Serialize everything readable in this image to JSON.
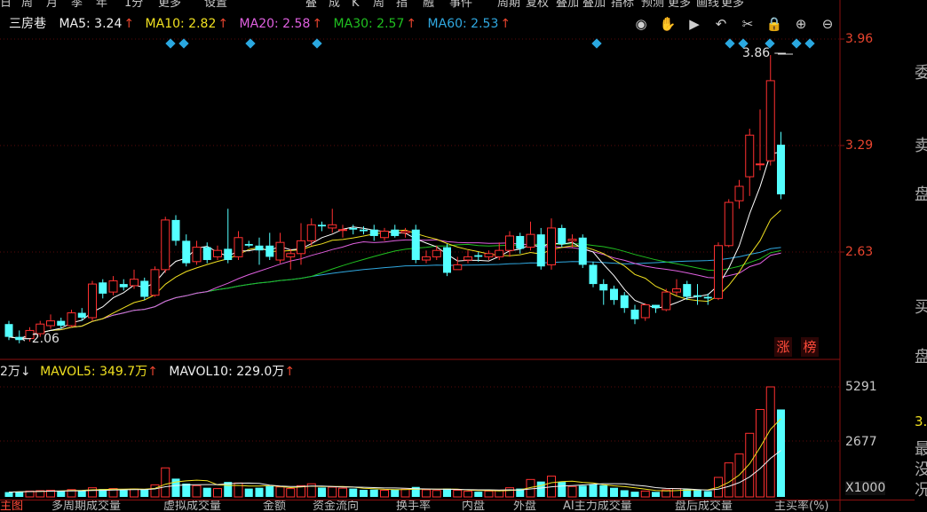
{
  "toolbar": {
    "items": [
      "日",
      "周",
      "月",
      "季",
      "年",
      "1分",
      "更多",
      "设置",
      "叠",
      "成",
      "K",
      "周",
      "指",
      "融",
      "事件",
      "周期",
      "复权",
      "叠加",
      "叠加",
      "指标",
      "预测",
      "更多",
      "画线",
      "更多"
    ]
  },
  "ma": {
    "stock_name": "三房巷",
    "ma5": "MA5: 3.24",
    "ma10": "MA10: 2.82",
    "ma20": "MA20: 2.58",
    "ma30": "MA30: 2.57",
    "ma60": "MA60: 2.53",
    "arrow": "↑",
    "colors": {
      "ma5": "#ffffff",
      "ma10": "#f0e020",
      "ma20": "#e060e0",
      "ma30": "#20c020",
      "ma60": "#30a8e0"
    }
  },
  "icons": [
    "eye-icon",
    "hand-icon",
    "play-icon",
    "undo-icon",
    "scissors-icon",
    "lock-icon",
    "zoom-in-icon",
    "zoom-out-icon"
  ],
  "price_axis": {
    "labels": [
      "3.96",
      "3.29",
      "2.63"
    ]
  },
  "annotations": {
    "high": "3.86",
    "low": "2.06"
  },
  "badges": [
    "涨",
    "榜"
  ],
  "volume": {
    "vol_prefix": "2万↓",
    "mavol5": "MAVOL5: 349.7万",
    "mavol10": "MAVOL10: 229.0万",
    "arrow": "↑",
    "axis": [
      "5291",
      "2677"
    ],
    "unit": "X1000"
  },
  "side_panel": [
    "委",
    "卖",
    "盘",
    "买",
    "盘",
    "3.",
    "最",
    "没",
    "况"
  ],
  "bottom_tabs": [
    "主图",
    "多周期成交量",
    "虚拟成交量",
    "金额",
    "资金流向",
    "换手率",
    "内盘",
    "外盘",
    "AI主力成交量",
    "盘后成交量",
    "主买率(%)"
  ],
  "chart_data": {
    "type": "candlestick",
    "price_axis_ticks": [
      3.96,
      3.29,
      2.63
    ],
    "volume_axis_ticks": [
      5291,
      2677
    ],
    "candles": [
      [
        2.18,
        2.1,
        2.2,
        2.08,
        210
      ],
      [
        2.1,
        2.08,
        2.14,
        2.06,
        230
      ],
      [
        2.09,
        2.14,
        2.16,
        2.07,
        260
      ],
      [
        2.12,
        2.18,
        2.2,
        2.1,
        280
      ],
      [
        2.17,
        2.2,
        2.24,
        2.15,
        300
      ],
      [
        2.2,
        2.17,
        2.22,
        2.15,
        270
      ],
      [
        2.17,
        2.25,
        2.27,
        2.16,
        330
      ],
      [
        2.25,
        2.22,
        2.28,
        2.2,
        290
      ],
      [
        2.22,
        2.43,
        2.45,
        2.2,
        420
      ],
      [
        2.44,
        2.37,
        2.46,
        2.34,
        360
      ],
      [
        2.38,
        2.45,
        2.48,
        2.36,
        380
      ],
      [
        2.43,
        2.41,
        2.46,
        2.39,
        300
      ],
      [
        2.42,
        2.46,
        2.52,
        2.4,
        360
      ],
      [
        2.45,
        2.35,
        2.47,
        2.33,
        340
      ],
      [
        2.36,
        2.52,
        2.54,
        2.35,
        560
      ],
      [
        2.52,
        2.83,
        2.85,
        2.5,
        1380
      ],
      [
        2.83,
        2.7,
        2.86,
        2.67,
        860
      ],
      [
        2.7,
        2.56,
        2.74,
        2.54,
        620
      ],
      [
        2.57,
        2.66,
        2.7,
        2.55,
        520
      ],
      [
        2.66,
        2.58,
        2.69,
        2.56,
        420
      ],
      [
        2.6,
        2.64,
        2.67,
        2.58,
        380
      ],
      [
        2.65,
        2.58,
        2.9,
        2.56,
        700
      ],
      [
        2.6,
        2.72,
        2.76,
        2.58,
        650
      ],
      [
        2.68,
        2.67,
        2.7,
        2.66,
        380
      ],
      [
        2.67,
        2.64,
        2.72,
        2.55,
        420
      ],
      [
        2.67,
        2.6,
        2.75,
        2.58,
        500
      ],
      [
        2.58,
        2.69,
        2.75,
        2.56,
        460
      ],
      [
        2.6,
        2.62,
        2.65,
        2.52,
        380
      ],
      [
        2.62,
        2.7,
        2.81,
        2.55,
        520
      ],
      [
        2.7,
        2.8,
        2.84,
        2.67,
        610
      ],
      [
        2.8,
        2.79,
        2.82,
        2.76,
        430
      ],
      [
        2.78,
        2.8,
        2.9,
        2.75,
        450
      ],
      [
        2.77,
        2.77,
        2.8,
        2.72,
        400
      ],
      [
        2.78,
        2.77,
        2.8,
        2.74,
        380
      ],
      [
        2.77,
        2.76,
        2.79,
        2.74,
        320
      ],
      [
        2.77,
        2.73,
        2.8,
        2.7,
        330
      ],
      [
        2.72,
        2.76,
        2.78,
        2.7,
        300
      ],
      [
        2.77,
        2.73,
        2.8,
        2.72,
        340
      ],
      [
        2.75,
        2.76,
        2.78,
        2.72,
        350
      ],
      [
        2.77,
        2.58,
        2.8,
        2.56,
        460
      ],
      [
        2.58,
        2.6,
        2.64,
        2.56,
        320
      ],
      [
        2.6,
        2.64,
        2.67,
        2.58,
        290
      ],
      [
        2.66,
        2.5,
        2.68,
        2.48,
        380
      ],
      [
        2.52,
        2.55,
        2.6,
        2.52,
        300
      ],
      [
        2.58,
        2.6,
        2.64,
        2.56,
        250
      ],
      [
        2.61,
        2.6,
        2.63,
        2.57,
        230
      ],
      [
        2.6,
        2.62,
        2.64,
        2.58,
        260
      ],
      [
        2.6,
        2.64,
        2.69,
        2.58,
        280
      ],
      [
        2.64,
        2.73,
        2.76,
        2.6,
        420
      ],
      [
        2.73,
        2.65,
        2.75,
        2.62,
        380
      ],
      [
        2.66,
        2.74,
        2.82,
        2.64,
        820
      ],
      [
        2.74,
        2.54,
        2.78,
        2.52,
        720
      ],
      [
        2.55,
        2.78,
        2.84,
        2.52,
        980
      ],
      [
        2.78,
        2.68,
        2.8,
        2.66,
        700
      ],
      [
        2.7,
        2.71,
        2.74,
        2.66,
        480
      ],
      [
        2.72,
        2.55,
        2.74,
        2.53,
        520
      ],
      [
        2.55,
        2.43,
        2.57,
        2.41,
        600
      ],
      [
        2.43,
        2.39,
        2.46,
        2.3,
        540
      ],
      [
        2.4,
        2.33,
        2.42,
        2.3,
        420
      ],
      [
        2.36,
        2.28,
        2.38,
        2.25,
        300
      ],
      [
        2.27,
        2.21,
        2.3,
        2.18,
        230
      ],
      [
        2.22,
        2.3,
        2.31,
        2.2,
        260
      ],
      [
        2.3,
        2.28,
        2.3,
        2.25,
        220
      ],
      [
        2.27,
        2.38,
        2.4,
        2.26,
        320
      ],
      [
        2.38,
        2.4,
        2.46,
        2.36,
        380
      ],
      [
        2.43,
        2.35,
        2.45,
        2.33,
        350
      ],
      [
        2.36,
        2.35,
        2.43,
        2.3,
        300
      ],
      [
        2.35,
        2.34,
        2.37,
        2.3,
        260
      ],
      [
        2.34,
        2.67,
        2.69,
        2.33,
        920
      ],
      [
        2.67,
        2.94,
        2.96,
        2.66,
        1620
      ],
      [
        2.95,
        3.04,
        3.08,
        2.9,
        2050
      ],
      [
        3.1,
        3.36,
        3.4,
        2.98,
        3050
      ],
      [
        3.18,
        3.18,
        3.52,
        3.14,
        4200
      ],
      [
        3.2,
        3.7,
        3.86,
        3.17,
        5291
      ],
      [
        3.3,
        2.99,
        3.38,
        2.96,
        4200
      ]
    ]
  }
}
